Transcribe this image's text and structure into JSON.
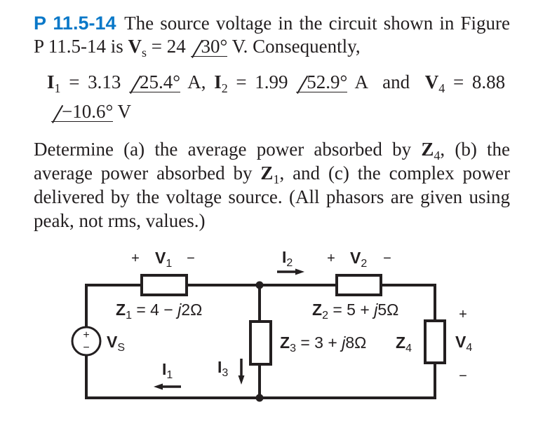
{
  "colors": {
    "accent": "#0a78c8",
    "text": "#231f20",
    "wire": "#231f20"
  },
  "problem": {
    "number": "P 11.5-14",
    "line1": "The source voltage in the circuit shown in Figure",
    "line2_prefix": "P 11.5-14 is",
    "source": {
      "symbol": "V",
      "sub": "s",
      "equals": "=",
      "magnitude": "24",
      "angle": "30°",
      "suffix": "V. Consequently,"
    }
  },
  "given": {
    "i1": {
      "symbol": "I",
      "sub": "1",
      "equals": "=",
      "magnitude": "3.13",
      "angle": "25.4°",
      "unit": "A,"
    },
    "i2": {
      "symbol": "I",
      "sub": "2",
      "equals": "=",
      "magnitude": "1.99",
      "angle": "52.9°",
      "unit": "A"
    },
    "connector": "and",
    "v4": {
      "symbol": "V",
      "sub": "4",
      "equals": "=",
      "magnitude": "8.88",
      "angle": "−10.6°",
      "unit": "V"
    }
  },
  "question": {
    "line1": {
      "pre": "Determine (a) the average power absorbed by",
      "symbol": "Z",
      "sub": "4",
      "post": ", (b) the"
    },
    "line2": {
      "pre": "average power absorbed by",
      "symbol": "Z",
      "sub": "1",
      "post": ", and (c) the complex power"
    },
    "line3": "delivered by the voltage source. (All phasors are given using",
    "line4": "peak, not rms, values.)"
  },
  "circuit": {
    "source": {
      "symbol": "V",
      "sub": "S",
      "plus": "+",
      "minus": "−"
    },
    "v1": {
      "plus": "+",
      "symbol": "V",
      "sub": "1",
      "minus": "−"
    },
    "v2": {
      "plus": "+",
      "symbol": "V",
      "sub": "2",
      "minus": "−"
    },
    "v4": {
      "plus": "+",
      "symbol": "V",
      "sub": "4",
      "minus": "−"
    },
    "z1": {
      "symbol": "Z",
      "sub": "1",
      "pre": " = 4 − ",
      "j": "j",
      "post": "2Ω"
    },
    "z2": {
      "symbol": "Z",
      "sub": "2",
      "pre": " = 5 + ",
      "j": "j",
      "post": "5Ω"
    },
    "z3": {
      "symbol": "Z",
      "sub": "3",
      "pre": " = 3 + ",
      "j": "j",
      "post": "8Ω"
    },
    "z4": {
      "symbol": "Z",
      "sub": "4"
    },
    "i1": {
      "symbol": "I",
      "sub": "1",
      "direction": "left"
    },
    "i2": {
      "symbol": "I",
      "sub": "2",
      "direction": "right"
    },
    "i3": {
      "symbol": "I",
      "sub": "3",
      "direction": "down"
    }
  }
}
